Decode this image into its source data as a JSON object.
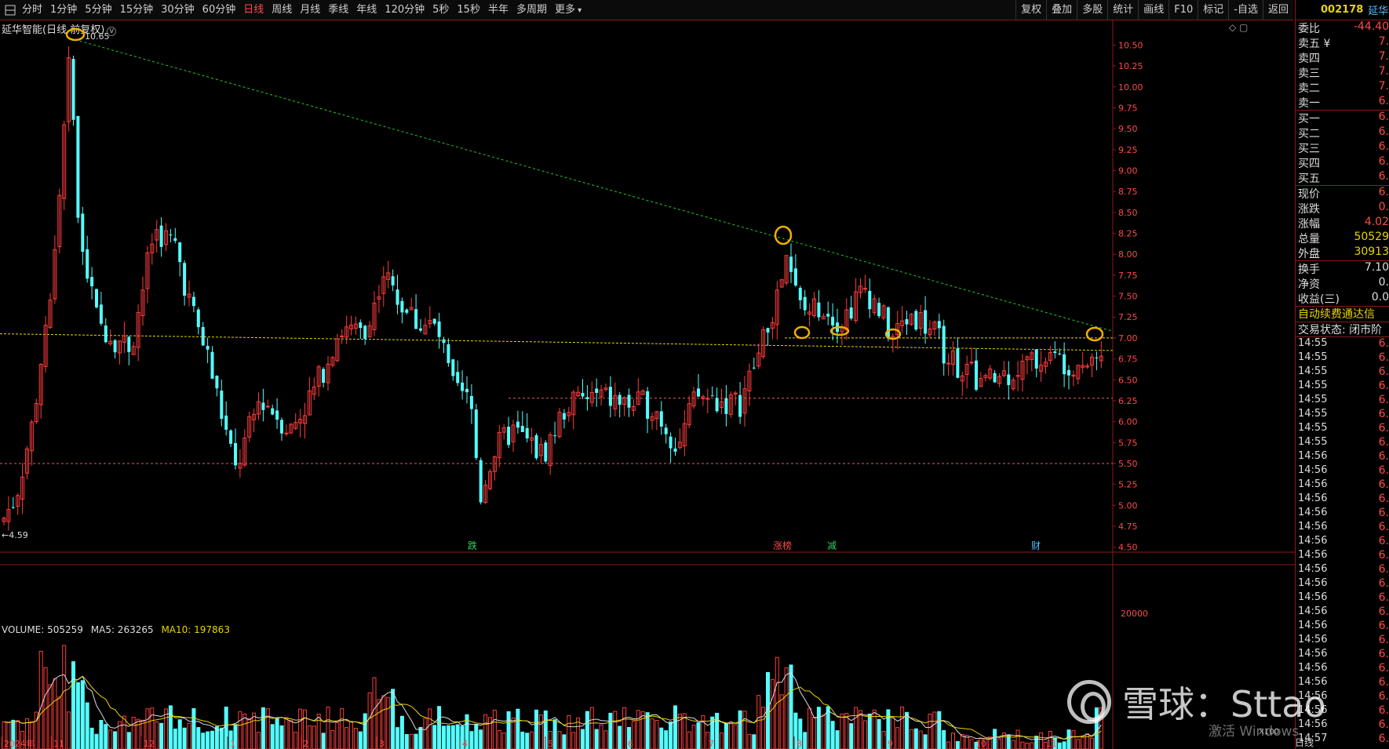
{
  "toolbar": {
    "period_tabs": [
      "分时",
      "1分钟",
      "5分钟",
      "15分钟",
      "30分钟",
      "60分钟",
      "日线",
      "周线",
      "月线",
      "季线",
      "年线",
      "120分钟",
      "5秒",
      "15秒",
      "半年",
      "多周期",
      "更多"
    ],
    "active_tab": "日线",
    "right_tools": [
      "复权",
      "叠加",
      "多股",
      "统计",
      "画线",
      "F10",
      "标记",
      "-自选",
      "返回"
    ]
  },
  "chart": {
    "title": "延华智能(日线 前复权)",
    "high_label": "10.65",
    "low_label": "←4.59",
    "price_ticks": [
      "10.50",
      "10.25",
      "10.00",
      "9.75",
      "9.50",
      "9.25",
      "9.00",
      "8.75",
      "8.50",
      "8.25",
      "8.00",
      "7.75",
      "7.50",
      "7.25",
      "7.00",
      "6.75",
      "6.50",
      "6.25",
      "6.00",
      "5.75",
      "5.50",
      "5.25",
      "5.00",
      "4.75",
      "4.50"
    ],
    "volume_ticks": [
      "20000",
      "X100"
    ],
    "time_labels": [
      "2024年",
      "11",
      "12",
      "1",
      "2",
      "3",
      "4",
      "5",
      "6",
      "7",
      "8",
      "9",
      "10",
      "11"
    ],
    "event_tags": [
      {
        "text": "跌",
        "color": "#30d060"
      },
      {
        "text": "涨榜",
        "color": "#ff4a4a"
      },
      {
        "text": "减",
        "color": "#30d060"
      },
      {
        "text": "财",
        "color": "#4ec1ff"
      }
    ],
    "colors": {
      "up": "#ff3b3b",
      "down": "#54ffff",
      "trendline": "#22cc22",
      "support": "#e8d400",
      "hline": "#e06060",
      "marker": "#f0b000"
    }
  },
  "chart_data": {
    "type": "candlestick",
    "price_range": [
      4.5,
      10.65
    ],
    "horizontal_lines": [
      {
        "price": 6.28,
        "color": "#e06060"
      },
      {
        "price": 5.5,
        "color": "#e06060"
      }
    ],
    "trendline": {
      "from_price": 10.58,
      "to_price": 7.08
    },
    "support_line": {
      "from_price": 7.05,
      "to_price": 6.85
    },
    "volume": {
      "value": "505259",
      "ma5": "263265",
      "ma10": "197863"
    }
  },
  "volume_legend": {
    "label": "VOLUME: 505259",
    "ma5": "MA5: 263265",
    "ma10": "MA10: 197863"
  },
  "quote": {
    "code": "002178",
    "name": "延华",
    "rows": [
      {
        "k": "委比",
        "v": "-44.40"
      },
      {
        "k": "卖五 ¥",
        "v": "7."
      },
      {
        "k": "卖四",
        "v": "7."
      },
      {
        "k": "卖三",
        "v": "7."
      },
      {
        "k": "卖二",
        "v": "7."
      },
      {
        "k": "卖一",
        "v": "6."
      }
    ],
    "bids": [
      {
        "k": "买一",
        "v": "6."
      },
      {
        "k": "买二",
        "v": "6."
      },
      {
        "k": "买三",
        "v": "6."
      },
      {
        "k": "买四",
        "v": "6."
      },
      {
        "k": "买五",
        "v": "6."
      }
    ],
    "stats": [
      {
        "k": "现价",
        "v": "6."
      },
      {
        "k": "涨跌",
        "v": "0."
      },
      {
        "k": "涨幅",
        "v": "4.02"
      },
      {
        "k": "总量",
        "v": "50529"
      },
      {
        "k": "外盘",
        "v": "30913"
      }
    ],
    "stats2": [
      {
        "k": "换手",
        "v": "7.10"
      },
      {
        "k": "净资",
        "v": "0."
      },
      {
        "k": "收益(三)",
        "v": "0.0"
      }
    ],
    "banner": "自动续费通达信",
    "status": "交易状态: 闭市阶",
    "ticks": [
      "14:55",
      "14:55",
      "14:55",
      "14:55",
      "14:55",
      "14:55",
      "14:55",
      "14:55",
      "14:56",
      "14:56",
      "14:56",
      "14:56",
      "14:56",
      "14:56",
      "14:56",
      "14:56",
      "14:56",
      "14:56",
      "14:56",
      "14:56",
      "14:56",
      "14:56",
      "14:56",
      "14:56",
      "14:56",
      "14:56",
      "14:56",
      "14:56",
      "14:57"
    ],
    "tick_values": "6."
  },
  "watermark": "雪球：Sttao",
  "windows_mark": "激活 Windows",
  "bottom_tab": "日线"
}
